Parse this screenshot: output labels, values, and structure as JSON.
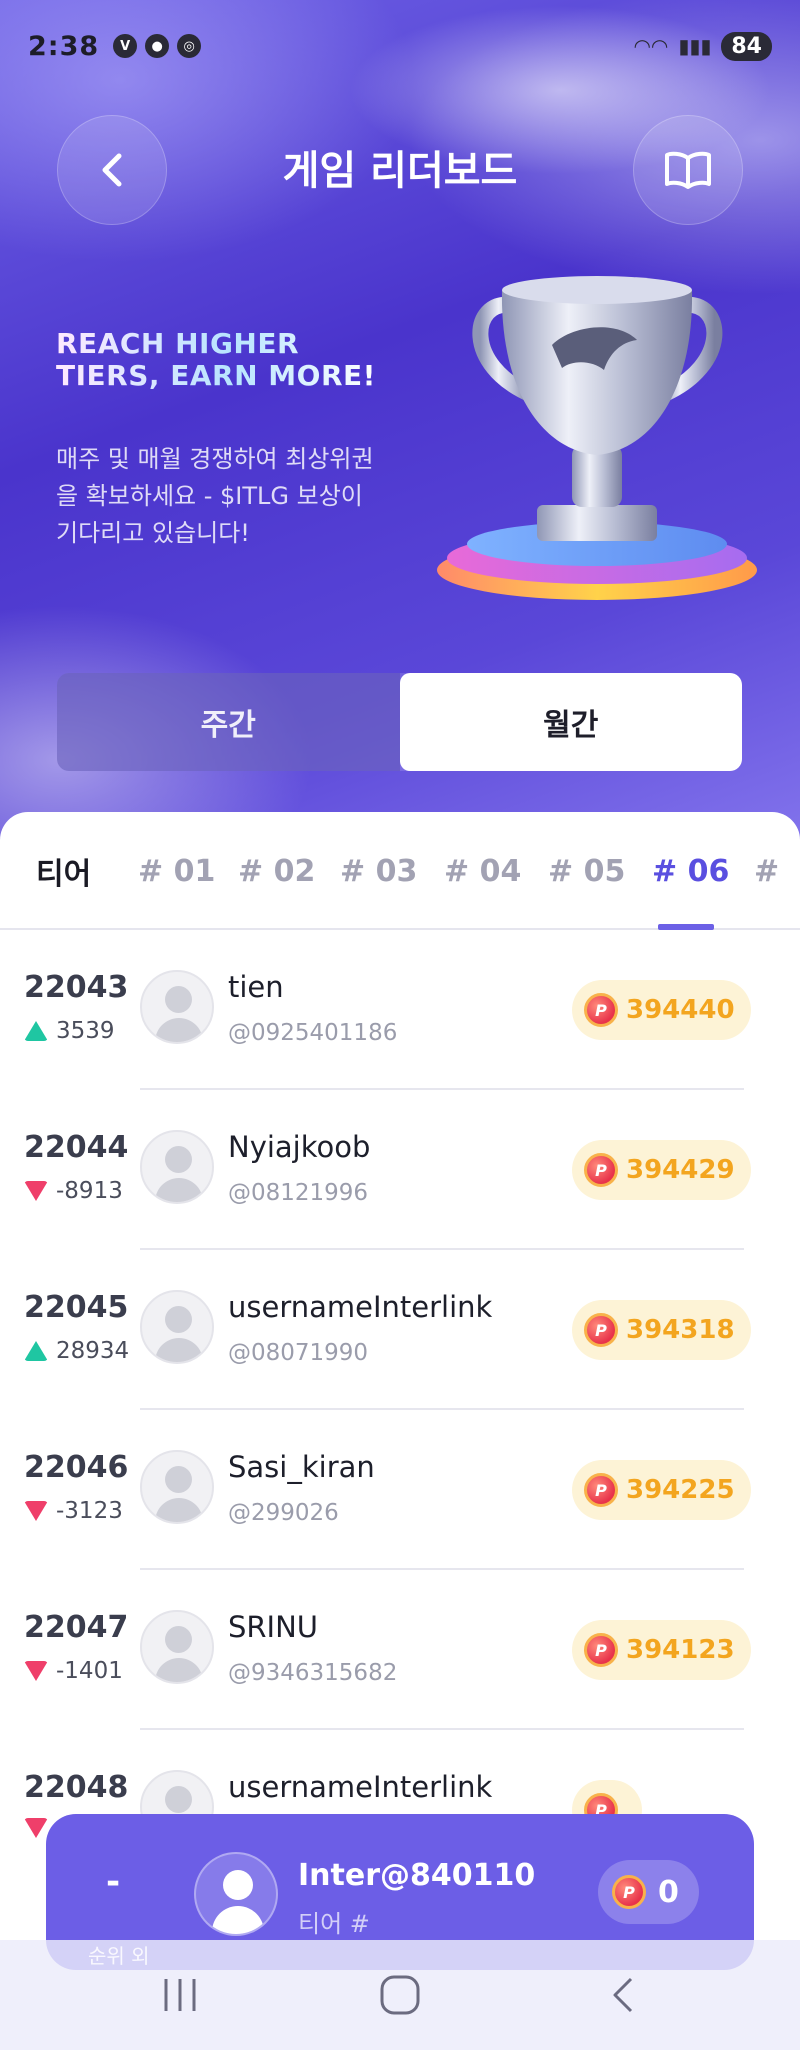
{
  "status_bar": {
    "time": "2:38",
    "battery": "84"
  },
  "header": {
    "title": "게임 리더보드"
  },
  "promo": {
    "headline_line1": "REACH HIGHER",
    "headline_line2": "TIERS, EARN MORE!",
    "description": "매주 및 매월 경쟁하여 최상위권을 확보하세요 - $ITLG 보상이 기다리고 있습니다!"
  },
  "period_toggle": {
    "weekly": "주간",
    "monthly": "월간",
    "selected": "monthly"
  },
  "tier_tabs": {
    "label": "티어",
    "tabs": [
      "# 01",
      "# 02",
      "# 03",
      "# 04",
      "# 05",
      "# 06",
      "#"
    ],
    "active_index": 5
  },
  "leaderboard": {
    "rows": [
      {
        "rank": "22043",
        "change": "3539",
        "direction": "up",
        "name": "tien",
        "handle": "@0925401186",
        "points": "394440"
      },
      {
        "rank": "22044",
        "change": "-8913",
        "direction": "down",
        "name": "Nyiajkoob",
        "handle": "@08121996",
        "points": "394429"
      },
      {
        "rank": "22045",
        "change": "28934",
        "direction": "up",
        "name": "usernameInterlink",
        "handle": "@08071990",
        "points": "394318"
      },
      {
        "rank": "22046",
        "change": "-3123",
        "direction": "down",
        "name": "Sasi_kiran",
        "handle": "@299026",
        "points": "394225"
      },
      {
        "rank": "22047",
        "change": "-1401",
        "direction": "down",
        "name": "SRINU",
        "handle": "@9346315682",
        "points": "394123"
      },
      {
        "rank": "22048",
        "change": "",
        "direction": "down",
        "name": "usernameInterlink",
        "handle": "",
        "points": ""
      }
    ]
  },
  "my_rank": {
    "rank": "-",
    "name": "Inter@840110",
    "tier": "티어 #",
    "points": "0",
    "sub_label": "순위 외"
  },
  "colors": {
    "accent": "#6c5ee6",
    "up": "#1fc6a2",
    "down": "#ef3f6a",
    "points": "#f3a51f"
  }
}
